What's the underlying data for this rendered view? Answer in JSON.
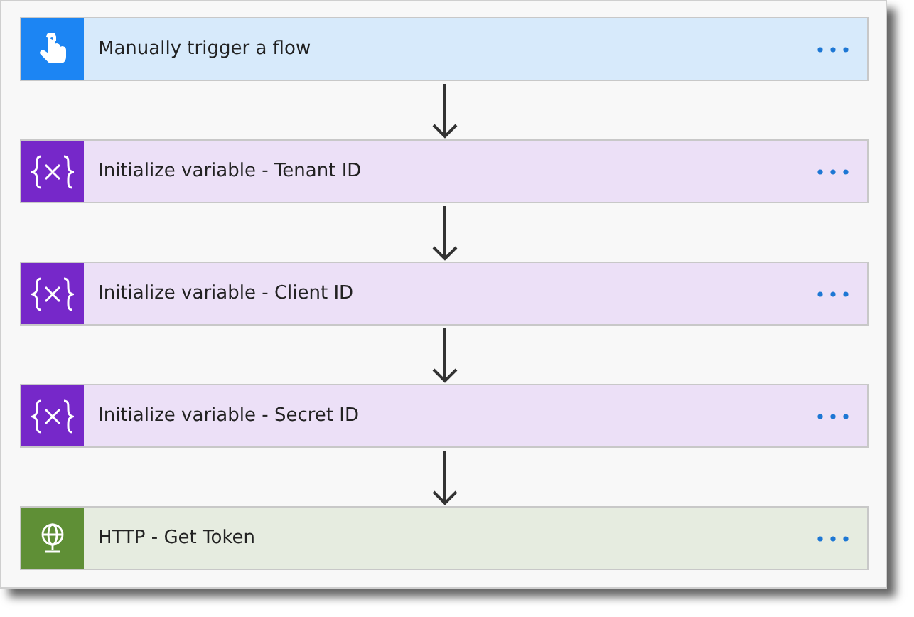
{
  "steps": [
    {
      "kind": "trigger",
      "title": "Manually trigger a flow"
    },
    {
      "kind": "variable",
      "title": "Initialize variable - Tenant ID"
    },
    {
      "kind": "variable",
      "title": "Initialize variable - Client ID"
    },
    {
      "kind": "variable",
      "title": "Initialize variable - Secret ID"
    },
    {
      "kind": "http",
      "title": "HTTP - Get Token"
    }
  ]
}
